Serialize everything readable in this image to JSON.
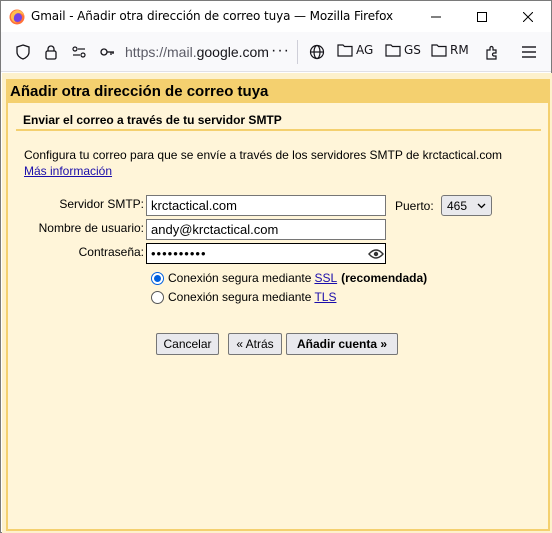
{
  "window": {
    "title": "Gmail - Añadir otra dirección de correo tuya — Mozilla Firefox"
  },
  "toolbar": {
    "url_prefix": "https://mail.",
    "url_domain": "google.com",
    "url_more": "···",
    "bookmarks": [
      {
        "label": "AG",
        "icon": "folder-icon"
      },
      {
        "label": "GS",
        "icon": "folder-icon"
      },
      {
        "label": "RM",
        "icon": "folder-icon"
      }
    ]
  },
  "dialog": {
    "title": "Añadir otra dirección de correo tuya",
    "subtitle": "Enviar el correo a través de tu servidor SMTP",
    "description": "Configura tu correo para que se envíe a través de los servidores SMTP de krctactical.com",
    "more_info_link": "Más información"
  },
  "form": {
    "smtp_label": "Servidor SMTP:",
    "smtp_value": "krctactical.com",
    "port_label": "Puerto:",
    "port_value": "465",
    "username_label": "Nombre de usuario:",
    "username_value": "andy@krctactical.com",
    "password_label": "Contraseña:",
    "password_value": "••••••••••",
    "ssl_option_text": "Conexión segura mediante ",
    "ssl_link": "SSL",
    "ssl_suffix": "(recomendada)",
    "ssl_selected": true,
    "tls_option_text": "Conexión segura mediante ",
    "tls_link": "TLS"
  },
  "buttons": {
    "cancel": "Cancelar",
    "back": "« Atrás",
    "add_account": "Añadir cuenta »"
  },
  "colors": {
    "header_bar": "#f4d06f",
    "panel_bg": "#fff5d9",
    "page_bg": "#fdf1cc",
    "link": "#1a0dab",
    "radio_accent": "#0060df"
  }
}
